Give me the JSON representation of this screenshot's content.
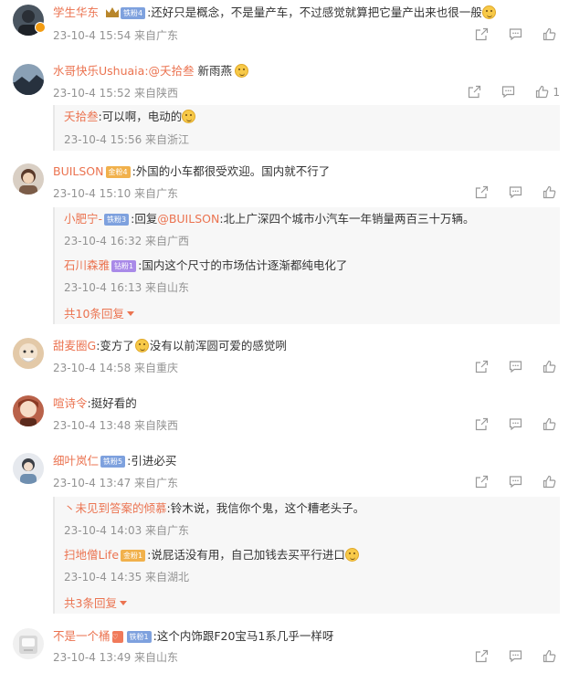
{
  "comments": [
    {
      "name": "学生华东",
      "badge": "铁粉4",
      "text": ":还好只是概念，不是量产车，不过感觉就算把它量产出来也很一般",
      "meta": "23-10-4 15:54 来自广东",
      "likes": ""
    },
    {
      "name": "水哥快乐Ushuaia",
      "mention": ":@夭拾叁",
      "text": " 新雨燕",
      "meta": "23-10-4 15:52 来自陕西",
      "likes": "1",
      "replies": [
        {
          "name": "夭拾叁",
          "text": ":可以啊，电动的",
          "meta": "23-10-4 15:56 来自浙江"
        }
      ]
    },
    {
      "name": "BUILSON",
      "badge": "金粉4",
      "text": ":外国的小车都很受欢迎。国内就不行了",
      "meta": "23-10-4 15:10 来自广东",
      "likes": "",
      "replies": [
        {
          "name": "小肥宁-",
          "badge": "铁粉3",
          "text_pre": ":回复",
          "mention": "@BUILSON",
          "text": ":北上广深四个城市小汽车一年销量两百三十万辆。",
          "meta": "23-10-4 16:32 来自广西"
        },
        {
          "name": "石川森雅",
          "badge": "钻粉1",
          "text": ":国内这个尺寸的市场估计逐渐都纯电化了",
          "meta": "23-10-4 16:13 来自山东"
        }
      ],
      "more": "共10条回复"
    },
    {
      "name": "甜麦圈G",
      "text": ":变方了",
      "text2": "没有以前浑圆可爱的感觉咧",
      "meta": "23-10-4 14:58 来自重庆",
      "likes": ""
    },
    {
      "name": "喧诗令",
      "text": ":挺好看的",
      "meta": "23-10-4 13:48 来自陕西",
      "likes": ""
    },
    {
      "name": "细叶岚仁",
      "badge": "铁粉5",
      "text": ":引进必买",
      "meta": "23-10-4 13:47 来自广东",
      "likes": "",
      "replies": [
        {
          "name": "丶未见到答案的倾慕",
          "text": ":铃木说，我信你个鬼，这个糟老头子。",
          "meta": "23-10-4 14:03 来自广东"
        },
        {
          "name": "扫地僧Life",
          "badge": "金粉1",
          "text": ":说屁话没有用，自己加钱去买平行进口",
          "meta": "23-10-4 14:35 来自湖北"
        }
      ],
      "more": "共3条回复"
    },
    {
      "name": "不是一个桶",
      "badge": "铁粉1",
      "text": ":这个内饰跟F20宝马1系几乎一样呀",
      "meta": "23-10-4 13:49 来自山东",
      "likes": ""
    }
  ],
  "icons": {
    "share": "share-icon",
    "comment": "comment-icon",
    "like": "thumb-up-icon"
  },
  "colors": {
    "name": "#eb7350",
    "meta": "#939393",
    "subbg": "#f7f7f7"
  }
}
